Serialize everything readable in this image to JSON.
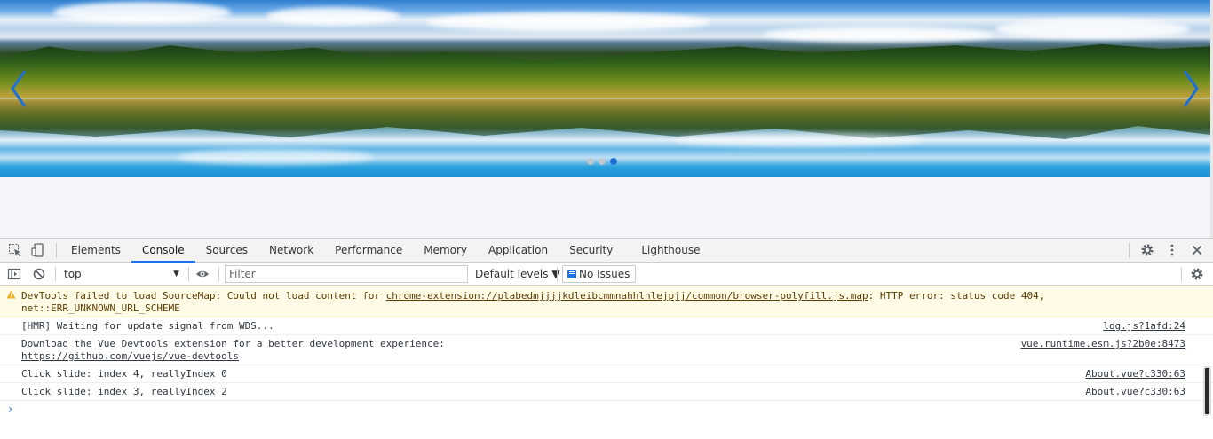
{
  "carousel": {
    "dots_count": 3,
    "active_dot": 2,
    "colors": {
      "active_dot": "#1e6fd9",
      "arrow": "#1e6fd9"
    }
  },
  "devtools": {
    "tabs": [
      "Elements",
      "Console",
      "Sources",
      "Network",
      "Performance",
      "Memory",
      "Application",
      "Security",
      "Lighthouse"
    ],
    "active_tab": "Console",
    "filterbar": {
      "context": "top",
      "filter_placeholder": "Filter",
      "levels": "Default levels ▼",
      "issues": "No Issues"
    },
    "messages": [
      {
        "type": "warning",
        "text_before": "DevTools failed to load SourceMap: Could not load content for ",
        "link": "chrome-extension://plabedmjjjjkdleibcmmnahhlnlejpjj/common/browser-polyfill.js.map",
        "text_after": ": HTTP error: status code 404,",
        "line2": "net::ERR_UNKNOWN_URL_SCHEME"
      },
      {
        "type": "log",
        "text": "[HMR] Waiting for update signal from WDS...",
        "source": "log.js?1afd:24"
      },
      {
        "type": "log",
        "text": "Download the Vue Devtools extension for a better development experience:",
        "link": "https://github.com/vuejs/vue-devtools",
        "source": "vue.runtime.esm.js?2b0e:8473"
      },
      {
        "type": "log",
        "text": "Click slide: index 4, reallyIndex 0",
        "source": "About.vue?c330:63"
      },
      {
        "type": "log",
        "text": "Click slide: index 3, reallyIndex 2",
        "source": "About.vue?c330:63"
      }
    ],
    "prompt": "›",
    "colors": {
      "accent": "#1a73e8",
      "warning_bg": "#fffbe6",
      "warning_text": "#5c3c00"
    }
  }
}
